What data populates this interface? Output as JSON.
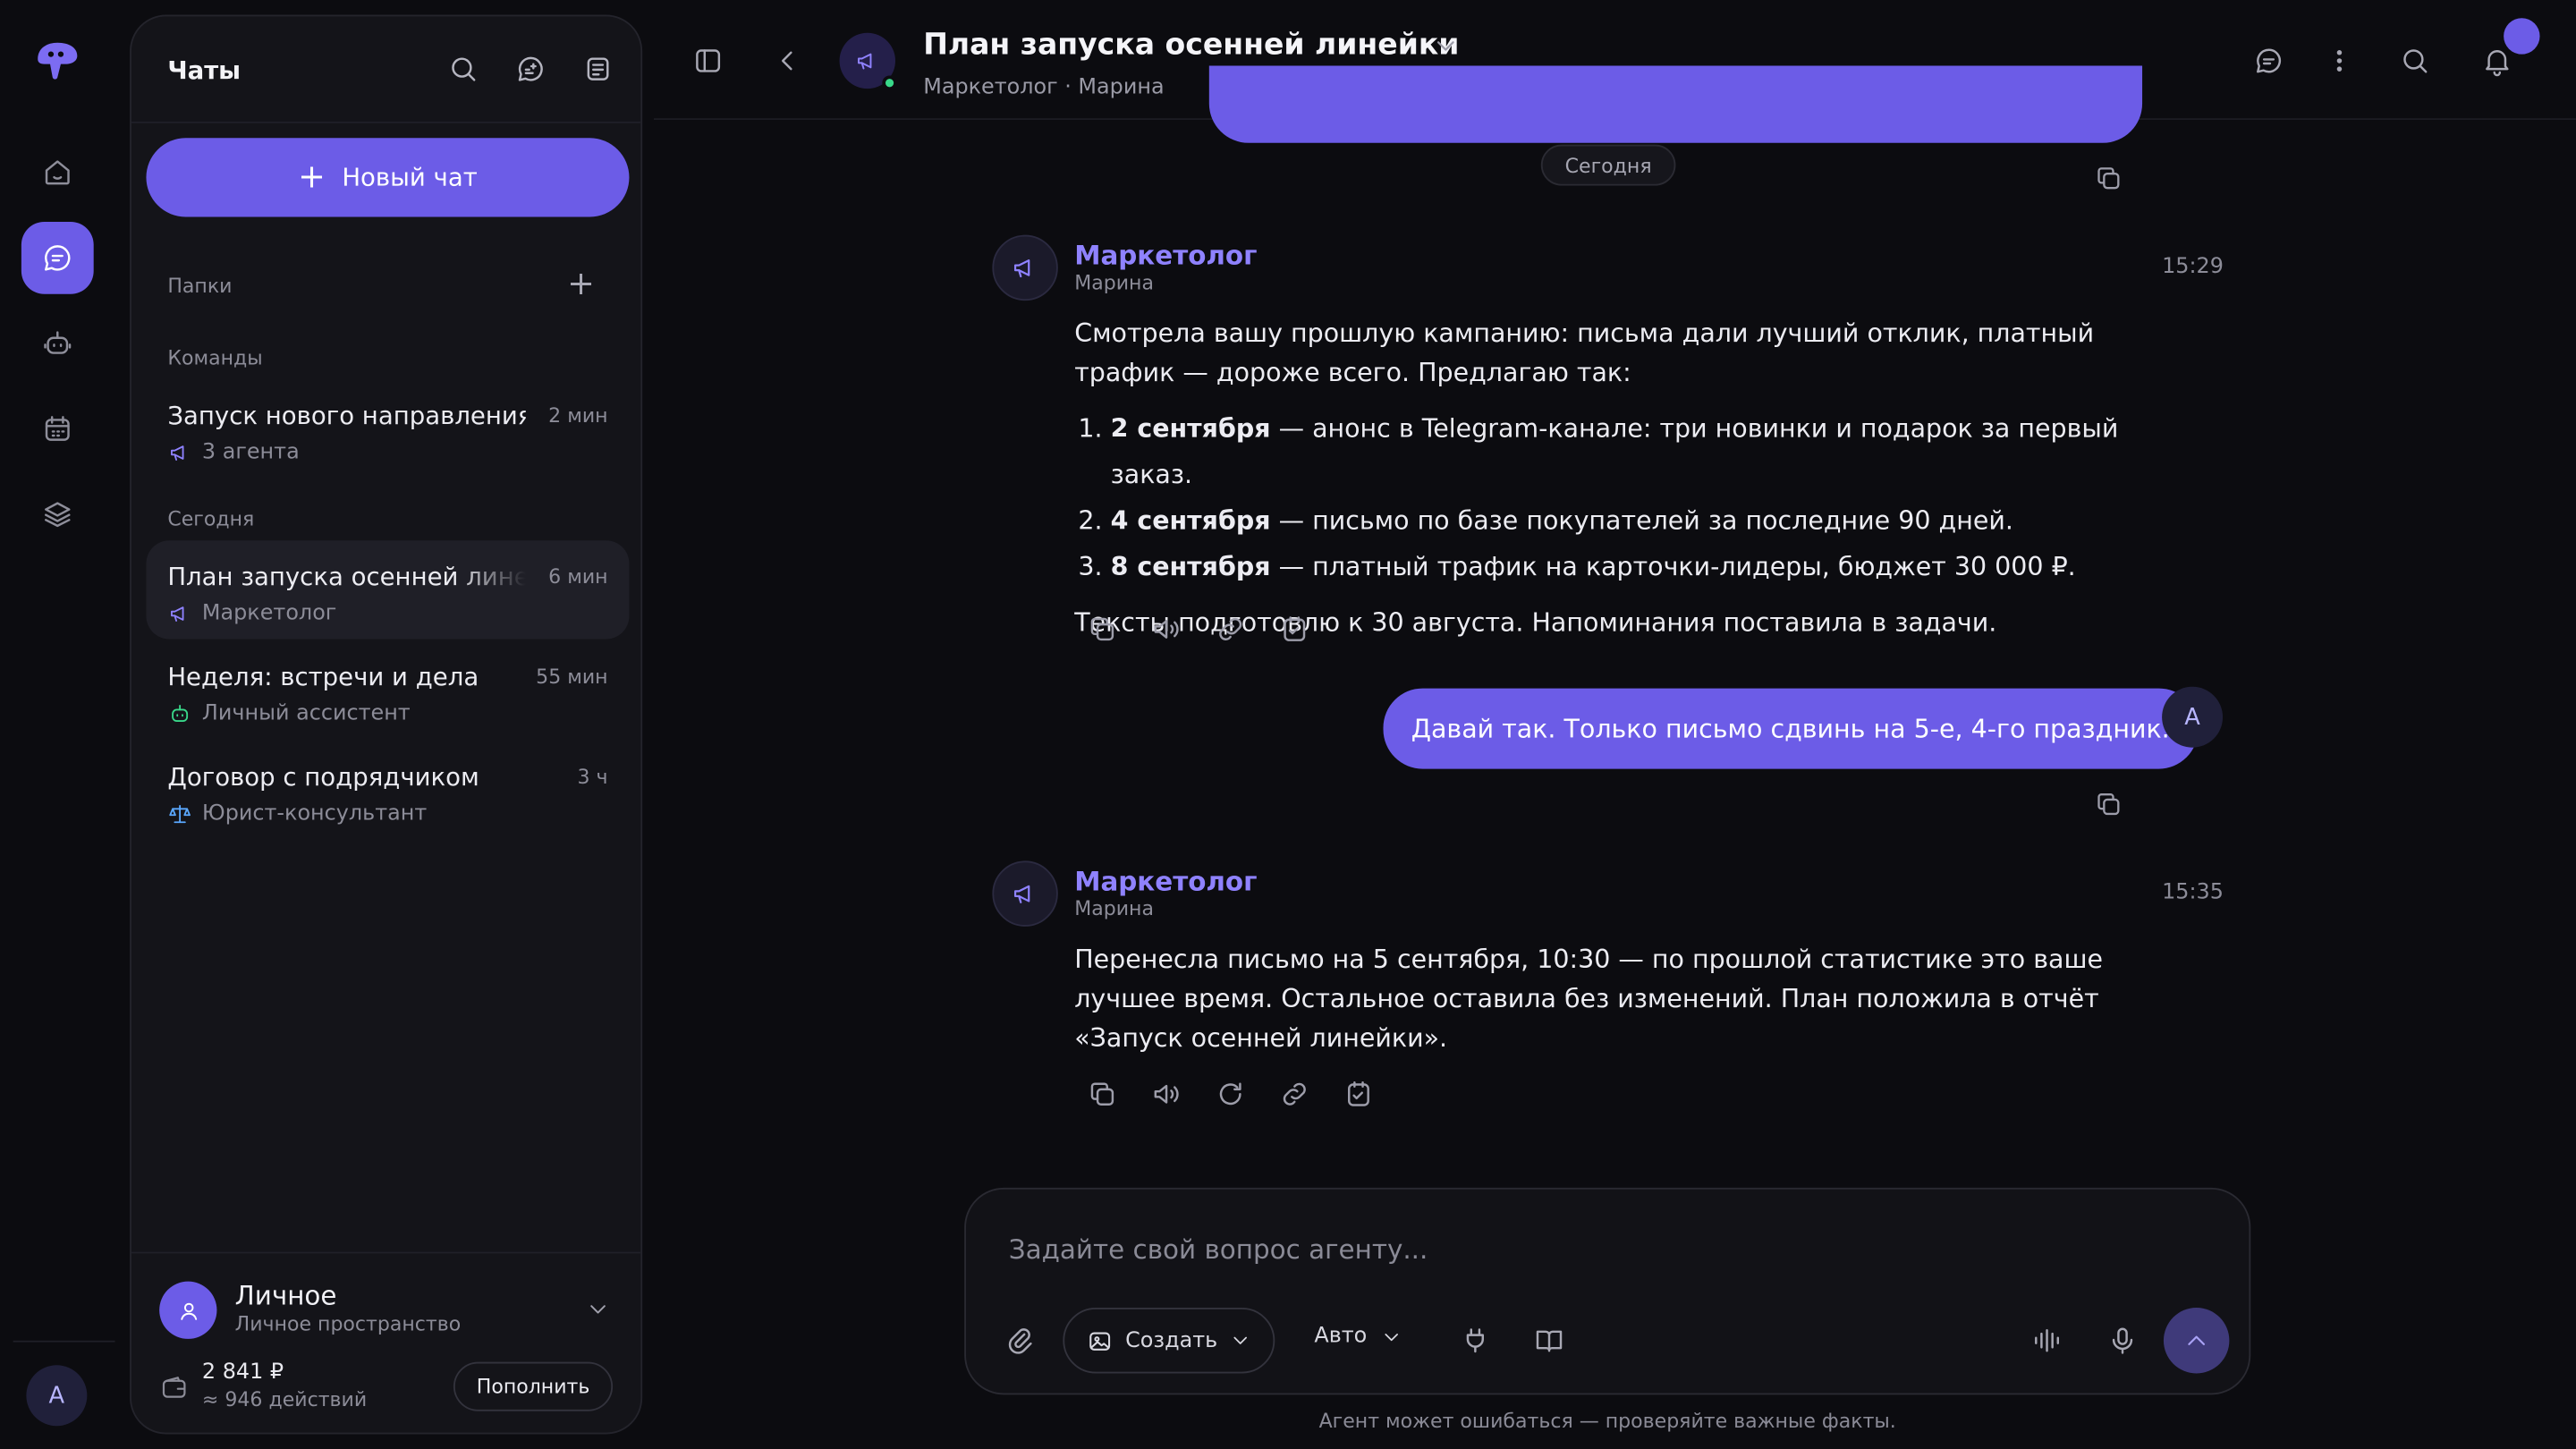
{
  "sidebar": {
    "title": "Чаты",
    "new_chat": "Новый чат",
    "folders_label": "Папки",
    "teams_label": "Команды",
    "today_label": "Сегодня",
    "items": [
      {
        "title": "Запуск нового направления",
        "time": "2 мин",
        "sub": "3 агента"
      },
      {
        "title": "План запуска осенней линейки",
        "time": "6 мин",
        "sub": "Маркетолог"
      },
      {
        "title": "Неделя: встречи и дела",
        "time": "55 мин",
        "sub": "Личный ассистент"
      },
      {
        "title": "Договор с подрядчиком",
        "time": "3 ч",
        "sub": "Юрист-консультант"
      }
    ],
    "workspace": {
      "name": "Личное",
      "sub": "Личное пространство"
    },
    "balance": {
      "amount": "2 841 ₽",
      "actions": "≈ 946 действий",
      "topup": "Пополнить"
    }
  },
  "rail": {
    "user_initial": "А"
  },
  "header": {
    "title": "План запуска осенней линейки",
    "subtitle": "Маркетолог · Марина"
  },
  "messages": {
    "day_label": "Сегодня",
    "m1": {
      "name": "Маркетолог",
      "role": "Марина",
      "time": "15:29",
      "intro": "Смотрела вашу прошлую кампанию: письма дали лучший отклик, платный трафик — дороже всего. Предлагаю так:",
      "list": [
        {
          "date": "2 сентября",
          "text": " — анонс в Telegram-канале: три новинки и подарок за первый заказ."
        },
        {
          "date": "4 сентября",
          "text": " — письмо по базе покупателей за последние 90 дней."
        },
        {
          "date": "8 сентября",
          "text": " — платный трафик на карточки-лидеры, бюджет 30 000 ₽."
        }
      ],
      "outro": "Тексты подготовлю к 30 августа. Напоминания поставила в задачи."
    },
    "user": {
      "text": "Давай так. Только письмо сдвинь на 5-е, 4-го праздник.",
      "initial": "А"
    },
    "m2": {
      "name": "Маркетолог",
      "role": "Марина",
      "time": "15:35",
      "text": "Перенесла письмо на 5 сентября, 10:30 — по прошлой статистике это ваше лучшее время. Остальное оставила без изменений. План положила в отчёт «Запуск осенней линейки»."
    }
  },
  "composer": {
    "placeholder": "Задайте свой вопрос агенту...",
    "create_label": "Создать",
    "mode_label": "Авто",
    "disclaimer": "Агент может ошибаться — проверяйте важные факты."
  },
  "colors": {
    "accent": "#6c5ce7",
    "online": "#39d98a"
  }
}
